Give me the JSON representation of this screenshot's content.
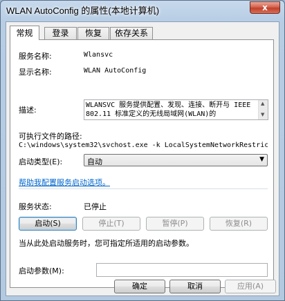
{
  "window": {
    "title": "WLAN AutoConfig 的属性(本地计算机)",
    "close_glyph": "x"
  },
  "tabs": [
    {
      "label": "常规",
      "selected": true
    },
    {
      "label": "登录",
      "selected": false
    },
    {
      "label": "恢复",
      "selected": false
    },
    {
      "label": "依存关系",
      "selected": false
    }
  ],
  "general": {
    "service_name_label": "服务名称:",
    "service_name": "Wlansvc",
    "display_name_label": "显示名称:",
    "display_name": "WLAN AutoConfig",
    "description_label": "描述:",
    "description": "WLANSVC 服务提供配置、发现、连接、断开与 IEEE 802.11 标准定义的无线局域网(WLAN)的",
    "exe_path_label": "可执行文件的路径:",
    "exe_path": "C:\\windows\\system32\\svchost.exe -k LocalSystemNetworkRestric",
    "startup_type_label": "启动类型(E):",
    "startup_type": "自动",
    "help_link": "帮助我配置服务启动选项。",
    "status_label": "服务状态:",
    "status_value": "已停止",
    "start_button": "启动(S)",
    "stop_button": "停止(T)",
    "pause_button": "暂停(P)",
    "resume_button": "恢复(R)",
    "start_hint": "当从此处启动服务时，您可指定所适用的启动参数。",
    "start_params_label": "启动参数(M):",
    "start_params_value": ""
  },
  "footer": {
    "ok_button": "确定",
    "cancel_button": "取消",
    "apply_button": "应用(A)"
  },
  "colors": {
    "link": "#0066cc",
    "title_bar": "#b7cde4",
    "close_button": "#c2402a"
  }
}
